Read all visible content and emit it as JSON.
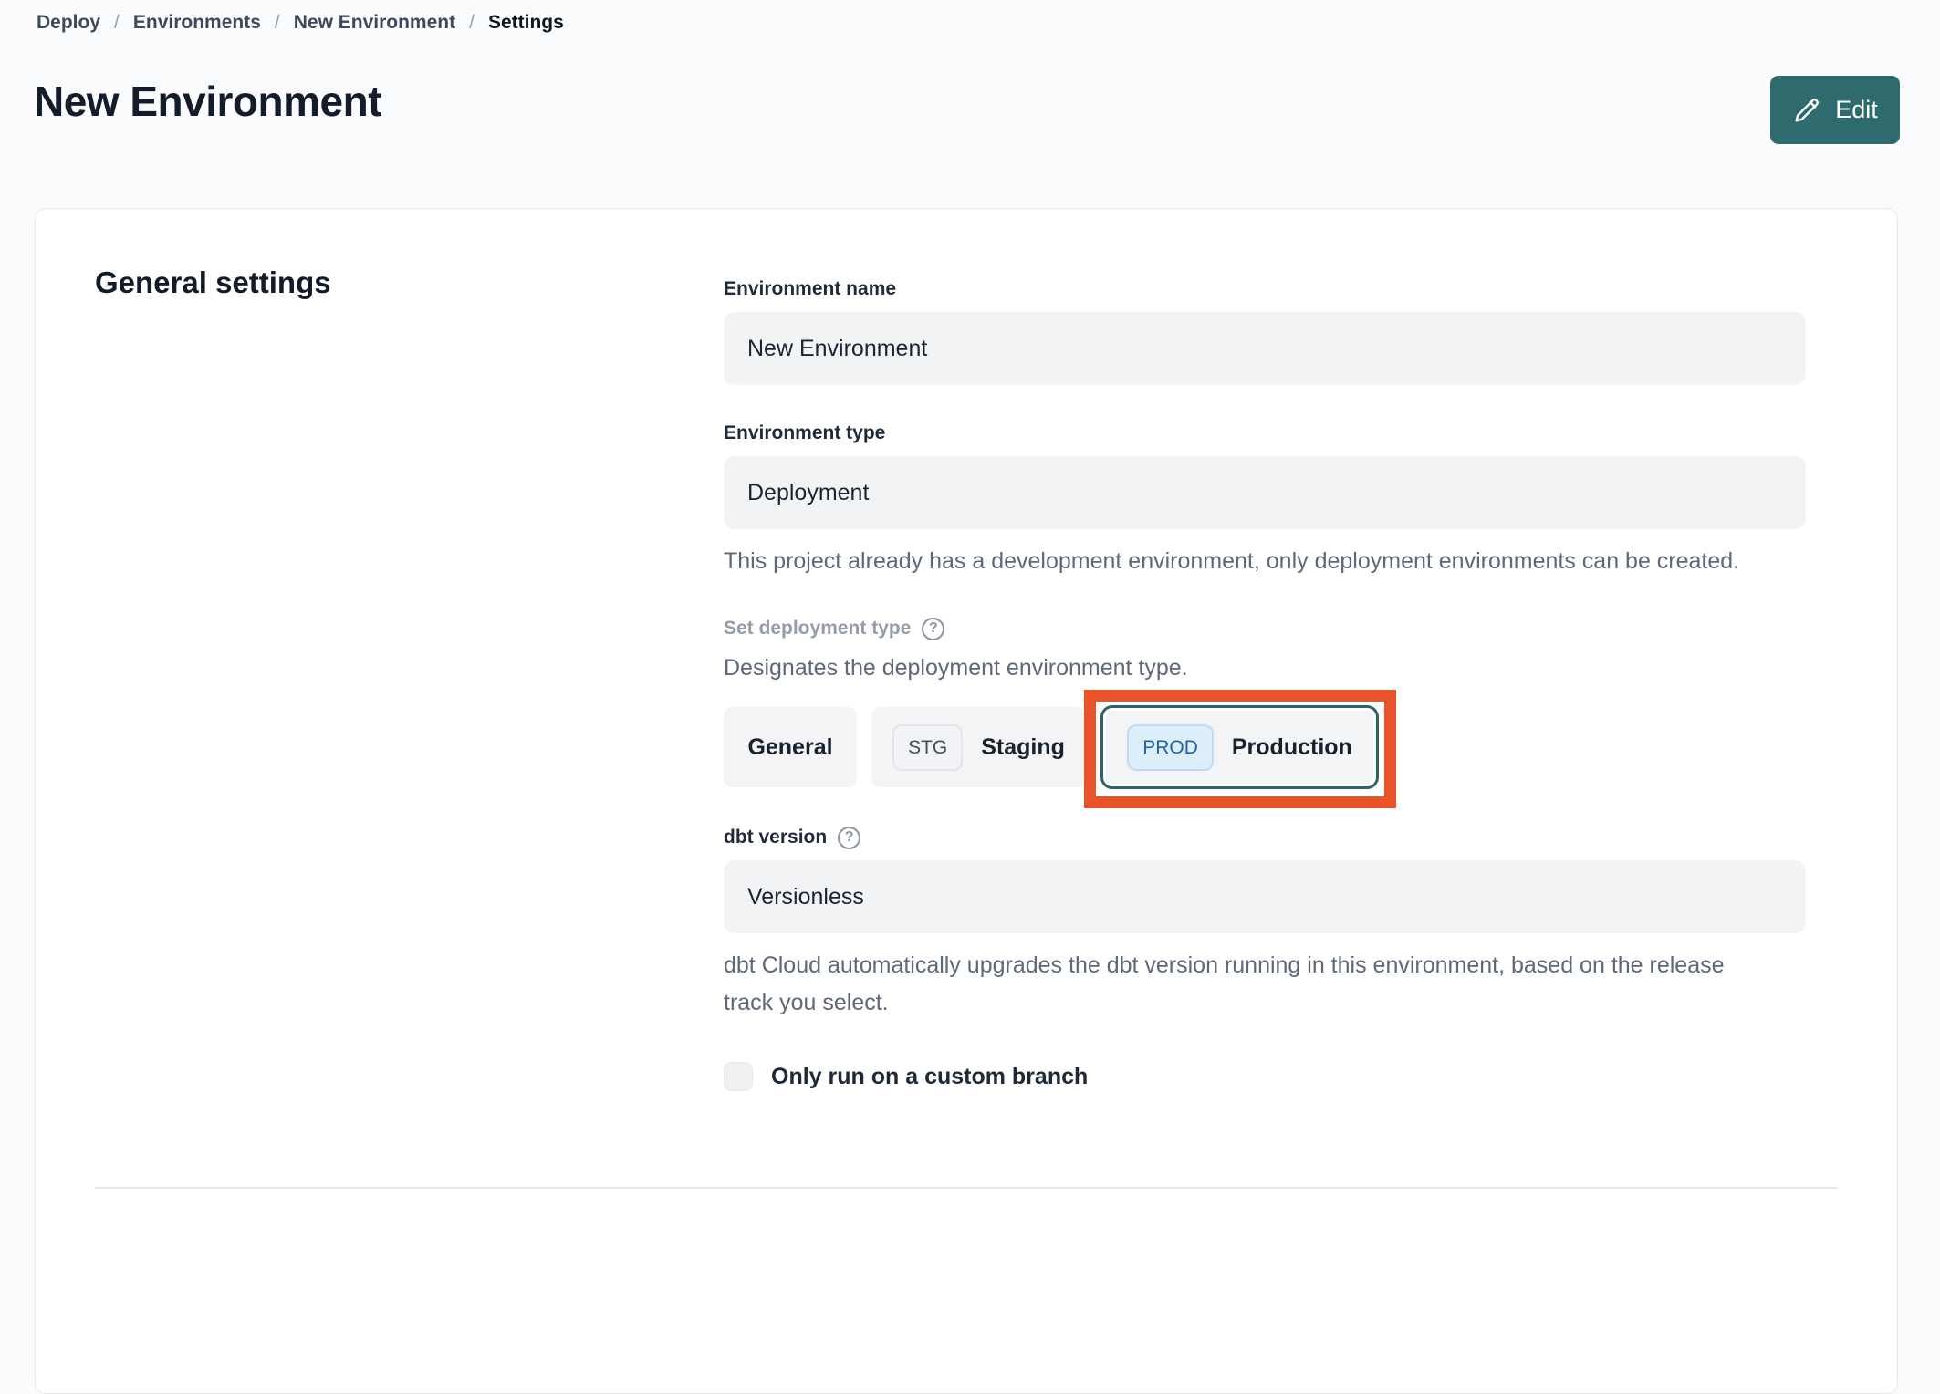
{
  "breadcrumb": {
    "separator": "/",
    "items": [
      "Deploy",
      "Environments",
      "New Environment"
    ],
    "current": "Settings"
  },
  "header": {
    "title": "New Environment",
    "edit_button": "Edit"
  },
  "icons": {
    "help": "?",
    "edit": "pencil-icon"
  },
  "panel": {
    "heading": "General settings",
    "environment_name": {
      "label": "Environment name",
      "value": "New Environment"
    },
    "environment_type": {
      "label": "Environment type",
      "value": "Deployment",
      "help_text": "This project already has a development environment, only deployment environments can be created."
    },
    "deployment_type": {
      "label": "Set deployment type",
      "description": "Designates the deployment environment type.",
      "options": [
        {
          "label": "General",
          "badge": "",
          "selected": false
        },
        {
          "label": "Staging",
          "badge": "STG",
          "selected": false
        },
        {
          "label": "Production",
          "badge": "PROD",
          "selected": true
        }
      ],
      "highlight_color": "#e85329"
    },
    "dbt_version": {
      "label": "dbt version",
      "value": "Versionless",
      "help_text": "dbt Cloud automatically upgrades the dbt version running in this environment, based on the release track you select."
    },
    "custom_branch": {
      "label": "Only run on a custom branch",
      "checked": false
    }
  },
  "colors": {
    "accent_teal": "#2f6a6f",
    "highlight_orange": "#e85329",
    "prod_badge_bg": "#ddeefb",
    "prod_badge_text": "#23639e",
    "field_bg": "#f2f3f4"
  }
}
